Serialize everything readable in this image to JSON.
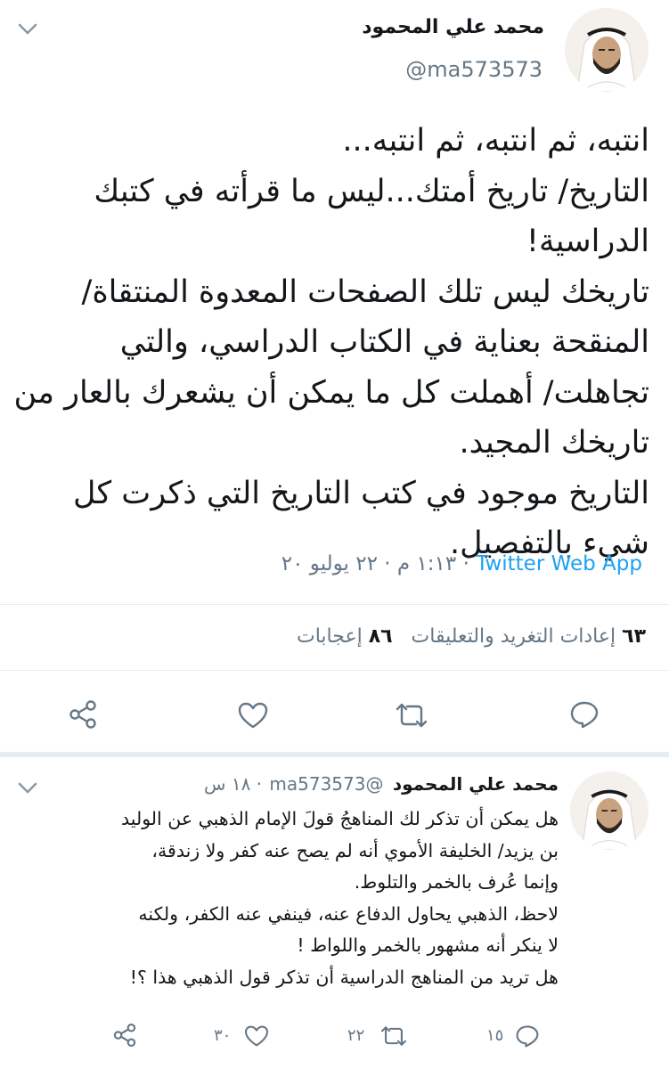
{
  "tweet": {
    "author_name": "محمد علي المحمود",
    "handle": "@ma573573",
    "body_lines": [
      "انتبه، ثم انتبه، ثم انتبه...",
      "التاريخ/ تاريخ أمتك...ليس ما قرأته في كتبك",
      "الدراسية!",
      "تاريخك ليس تلك الصفحات المعدوة المنتقاة/",
      "المنقحة بعناية في الكتاب الدراسي، والتي",
      "تجاهلت/ أهملت كل ما يمكن أن يشعرك بالعار من",
      "تاريخك المجيد.",
      "التاريخ موجود في كتب التاريخ التي ذكرت كل",
      "شيء بالتفصيل."
    ],
    "time_date": "١:١٣ م · ٢٢ يوليو ٢٠ ·",
    "source": "Twitter Web App",
    "retweets_count": "٦٣",
    "retweets_label": "إعادات التغريد والتعليقات",
    "likes_count": "٨٦",
    "likes_label": "إعجابات"
  },
  "reply": {
    "author_name": "محمد علي المحمود",
    "handle": "@ma573573",
    "time": "· ١٨ س",
    "body_lines": [
      "هل يمكن أن تذكر لك المناهجُ قولَ الإمام الذهبي عن الوليد",
      "بن يزيد/ الخليفة الأموي أنه لم يصح عنه كفر ولا زندقة،",
      "وإنما عُرف بالخمر والتلوط.",
      "لاحظ، الذهبي يحاول الدفاع عنه، فينفي عنه الكفر، ولكنه",
      "لا ينكر أنه مشهور بالخمر واللواط !",
      "هل تريد من المناهج الدراسية أن تذكر قول الذهبي هذا ؟!"
    ],
    "reply_count": "١٥",
    "retweet_count": "٢٢",
    "like_count": "٣٠"
  },
  "icons": {
    "chevron": "chevron-down-icon",
    "reply": "reply-icon",
    "retweet": "retweet-icon",
    "like": "heart-icon",
    "share": "share-icon"
  },
  "colors": {
    "accent": "#1da1f2",
    "secondary_text": "#657786",
    "divider": "#e6ecf0"
  }
}
